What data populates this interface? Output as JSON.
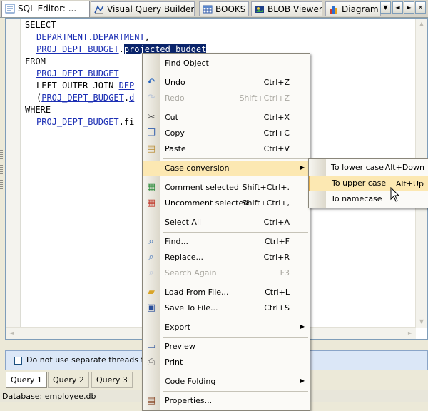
{
  "tabs": [
    {
      "label": "SQL Editor: ...",
      "icon": "sql-editor-icon",
      "active": true
    },
    {
      "label": "Visual Query Builder",
      "icon": "query-builder-icon"
    },
    {
      "label": "BOOKS",
      "icon": "table-icon"
    },
    {
      "label": "BLOB Viewer",
      "icon": "blob-icon"
    },
    {
      "label": "Diagram",
      "icon": "diagram-icon"
    }
  ],
  "nav": {
    "down": "▼",
    "left": "◄",
    "right": "►",
    "close": "✕"
  },
  "code": {
    "l1": "SELECT",
    "l2a": "DEPARTMENT",
    "l2b": ".",
    "l2c": "DEPARTMENT",
    "l2d": ",",
    "l3a": "PROJ_DEPT_BUDGET",
    "l3b": ".",
    "l3c": "projected_budget",
    "l4": "FROM",
    "l5": "PROJ_DEPT_BUDGET",
    "l6a": "LEFT OUTER JOIN ",
    "l6b": "DEP",
    "l7a": "(",
    "l7b": "PROJ_DEPT_BUDGET",
    "l7c": ".",
    "l7d": "d",
    "l8": "WHERE",
    "l9a": "PROJ_DEPT_BUDGET",
    "l9b": ".fi"
  },
  "option": {
    "label": "Do not use separate threads for e"
  },
  "query_tabs": [
    "Query 1",
    "Query 2",
    "Query 3"
  ],
  "status": "Database: employee.db",
  "context_menu": [
    {
      "label": "Find Object",
      "shortcut": ""
    },
    {
      "label": "Undo",
      "shortcut": "Ctrl+Z",
      "icon": "undo-icon"
    },
    {
      "label": "Redo",
      "shortcut": "Shift+Ctrl+Z",
      "icon": "redo-icon",
      "disabled": true
    },
    {
      "label": "Cut",
      "shortcut": "Ctrl+X",
      "icon": "cut-icon"
    },
    {
      "label": "Copy",
      "shortcut": "Ctrl+C",
      "icon": "copy-icon"
    },
    {
      "label": "Paste",
      "shortcut": "Ctrl+V",
      "icon": "paste-icon"
    },
    {
      "label": "Case conversion",
      "shortcut": "",
      "submenu": true,
      "highlighted": true
    },
    {
      "label": "Comment selected",
      "shortcut": "Shift+Ctrl+.",
      "icon": "comment-icon"
    },
    {
      "label": "Uncomment selected",
      "shortcut": "Shift+Ctrl+,",
      "icon": "uncomment-icon"
    },
    {
      "label": "Select All",
      "shortcut": "Ctrl+A"
    },
    {
      "label": "Find...",
      "shortcut": "Ctrl+F",
      "icon": "find-icon"
    },
    {
      "label": "Replace...",
      "shortcut": "Ctrl+R",
      "icon": "replace-icon"
    },
    {
      "label": "Search Again",
      "shortcut": "F3",
      "icon": "search-again-icon",
      "disabled": true
    },
    {
      "label": "Load From File...",
      "shortcut": "Ctrl+L",
      "icon": "open-folder-icon"
    },
    {
      "label": "Save To File...",
      "shortcut": "Ctrl+S",
      "icon": "save-icon"
    },
    {
      "label": "Export",
      "shortcut": "",
      "submenu": true
    },
    {
      "label": "Preview",
      "shortcut": "",
      "icon": "preview-icon"
    },
    {
      "label": "Print",
      "shortcut": "",
      "icon": "print-icon"
    },
    {
      "label": "Code Folding",
      "shortcut": "",
      "submenu": true
    },
    {
      "label": "Properties...",
      "shortcut": "",
      "icon": "properties-icon"
    }
  ],
  "submenu": [
    {
      "label": "To lower case",
      "shortcut": "Alt+Down"
    },
    {
      "label": "To upper case",
      "shortcut": "Alt+Up",
      "highlighted": true
    },
    {
      "label": "To namecase",
      "shortcut": ""
    }
  ],
  "colors": {
    "selection": "#0a246a",
    "link": "#1c2fb4",
    "menu_highlight": "#fce8b2",
    "highlight_border": "#e4ad4a"
  }
}
